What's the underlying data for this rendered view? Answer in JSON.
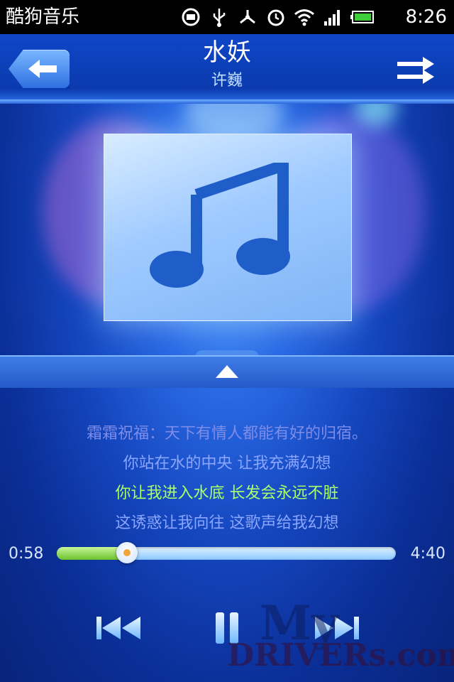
{
  "status_bar": {
    "app_name": "酷狗音乐",
    "time": "8:26",
    "icons": [
      "mm-icon",
      "usb-icon",
      "debug-icon",
      "alarm-icon",
      "wifi-icon",
      "signal-icon",
      "battery-icon"
    ]
  },
  "header": {
    "song_title": "水妖",
    "artist": "许巍",
    "back_icon": "back-arrow-icon",
    "mode_icon": "shuffle-icon"
  },
  "album_art": {
    "icon": "music-note-icon"
  },
  "expand": {
    "icon": "expand-up-icon"
  },
  "lyrics": [
    "霜霜祝福：天下有情人都能有好的归宿。",
    "你站在水的中央 让我充满幻想",
    "你让我进入水底 长发会永远不脏",
    "这诱惑让我向往 这歌声给我幻想"
  ],
  "lyric_current_index": 2,
  "progress": {
    "current": "0:58",
    "total": "4:40",
    "fraction": 0.207
  },
  "controls": {
    "prev_icon": "previous-track-icon",
    "pause_icon": "pause-icon",
    "next_icon": "next-track-icon"
  },
  "watermark": {
    "line1": "My",
    "line2": "DRIVERs.com"
  },
  "colors": {
    "background": "#0b2f98",
    "current_lyric": "#a8ff6a",
    "lyric": "#8aa6ff",
    "progress_fill": "#6cc22c"
  }
}
